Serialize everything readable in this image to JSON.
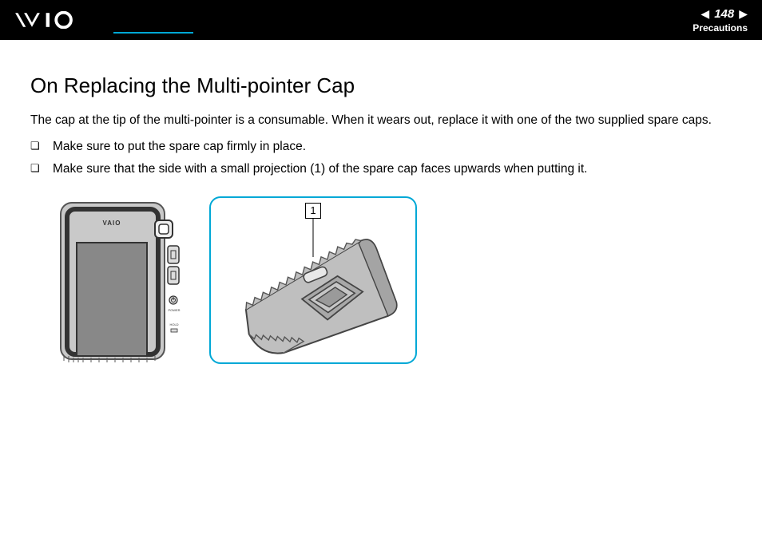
{
  "header": {
    "logo_alt": "VAIO",
    "page_number": "148",
    "section": "Precautions"
  },
  "content": {
    "title": "On Replacing the Multi-pointer Cap",
    "intro": "The cap at the tip of the multi-pointer is a consumable. When it wears out, replace it with one of the two supplied spare caps.",
    "bullets": [
      "Make sure to put the spare cap firmly in place.",
      "Make sure that the side with a small projection (1) of the spare cap faces upwards when putting it."
    ],
    "callout_label": "1"
  }
}
